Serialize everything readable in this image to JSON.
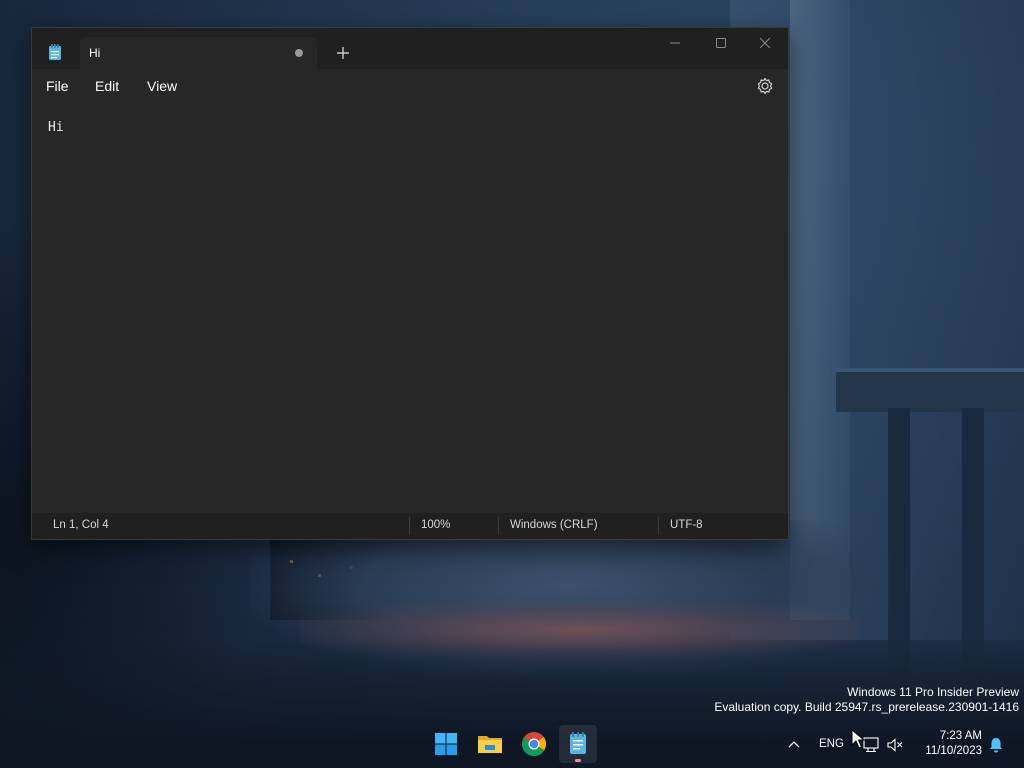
{
  "notepad": {
    "tab_title": "Hi",
    "menu": {
      "file": "File",
      "edit": "Edit",
      "view": "View"
    },
    "editor_text": "Hi",
    "status": {
      "position": "Ln 1, Col 4",
      "zoom": "100%",
      "line_ending": "Windows (CRLF)",
      "encoding": "UTF-8"
    },
    "unsaved": true
  },
  "watermark": {
    "line1": "Windows 11 Pro Insider Preview",
    "line2": "Evaluation copy. Build 25947.rs_prerelease.230901-1416"
  },
  "taskbar": {
    "apps": [
      {
        "name": "start",
        "icon": "windows-logo-icon"
      },
      {
        "name": "file-explorer",
        "icon": "folder-icon"
      },
      {
        "name": "chrome",
        "icon": "chrome-icon"
      },
      {
        "name": "notepad",
        "icon": "notepad-icon",
        "active": true
      }
    ],
    "tray": {
      "language": "ENG",
      "time": "7:23 AM",
      "date": "11/10/2023"
    }
  },
  "colors": {
    "window_bg": "#272727",
    "titlebar_bg": "#202020",
    "accent_notepad": "#5ab6e0",
    "taskbar_indicator": "#f28b9a"
  }
}
